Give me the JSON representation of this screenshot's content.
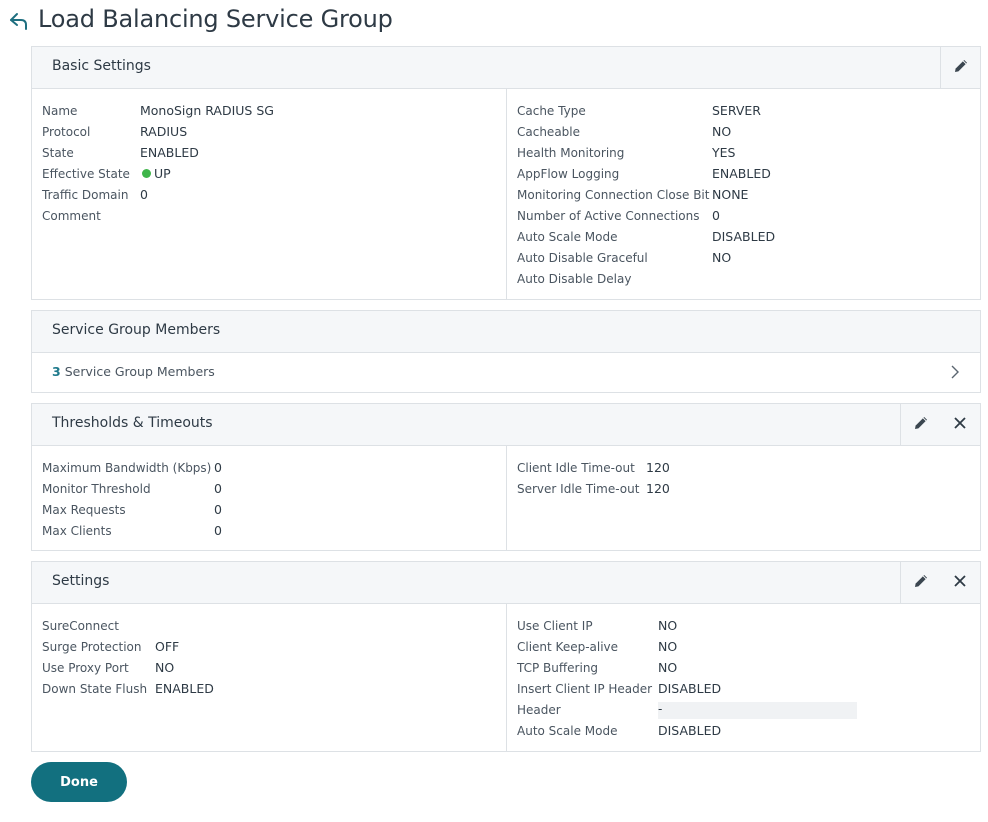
{
  "page": {
    "title": "Load Balancing Service Group"
  },
  "basic_settings": {
    "title": "Basic Settings",
    "left": [
      {
        "label": "Name",
        "value": "MonoSign RADIUS SG"
      },
      {
        "label": "Protocol",
        "value": "RADIUS"
      },
      {
        "label": "State",
        "value": "ENABLED"
      },
      {
        "label": "Effective State",
        "value": "UP"
      },
      {
        "label": "Traffic Domain",
        "value": "0"
      },
      {
        "label": "Comment",
        "value": ""
      }
    ],
    "right": [
      {
        "label": "Cache Type",
        "value": "SERVER"
      },
      {
        "label": "Cacheable",
        "value": "NO"
      },
      {
        "label": "Health Monitoring",
        "value": "YES"
      },
      {
        "label": "AppFlow Logging",
        "value": "ENABLED"
      },
      {
        "label": "Monitoring Connection Close Bit",
        "value": "NONE"
      },
      {
        "label": "Number of Active Connections",
        "value": "0"
      },
      {
        "label": "Auto Scale Mode",
        "value": "DISABLED"
      },
      {
        "label": "Auto Disable Graceful",
        "value": "NO"
      },
      {
        "label": "Auto Disable Delay",
        "value": ""
      }
    ]
  },
  "members": {
    "title": "Service Group Members",
    "count": "3",
    "link_label": "Service Group Members"
  },
  "thresholds": {
    "title": "Thresholds & Timeouts",
    "left": [
      {
        "label": "Maximum Bandwidth (Kbps)",
        "value": "0"
      },
      {
        "label": "Monitor Threshold",
        "value": "0"
      },
      {
        "label": "Max Requests",
        "value": "0"
      },
      {
        "label": "Max Clients",
        "value": "0"
      }
    ],
    "right": [
      {
        "label": "Client Idle Time-out",
        "value": "120"
      },
      {
        "label": "Server Idle Time-out",
        "value": "120"
      }
    ]
  },
  "settings": {
    "title": "Settings",
    "left": [
      {
        "label": "SureConnect",
        "value": ""
      },
      {
        "label": "Surge Protection",
        "value": "OFF"
      },
      {
        "label": "Use Proxy Port",
        "value": "NO"
      },
      {
        "label": "Down State Flush",
        "value": "ENABLED"
      }
    ],
    "right": [
      {
        "label": "Use Client IP",
        "value": "NO"
      },
      {
        "label": "Client Keep-alive",
        "value": "NO"
      },
      {
        "label": "TCP Buffering",
        "value": "NO"
      },
      {
        "label": "Insert Client IP Header",
        "value": "DISABLED"
      },
      {
        "label": "Header",
        "value": "-"
      },
      {
        "label": "Auto Scale Mode",
        "value": "DISABLED"
      }
    ]
  },
  "footer": {
    "done_label": "Done"
  },
  "colors": {
    "accent": "#12707f",
    "status_up": "#3fb54a",
    "panel_header_bg": "#f5f7f9",
    "border": "#dde1e5"
  },
  "icons": {
    "back": "back-arrow-icon",
    "edit": "pencil-icon",
    "close": "close-icon",
    "chevron": "chevron-right-icon"
  }
}
